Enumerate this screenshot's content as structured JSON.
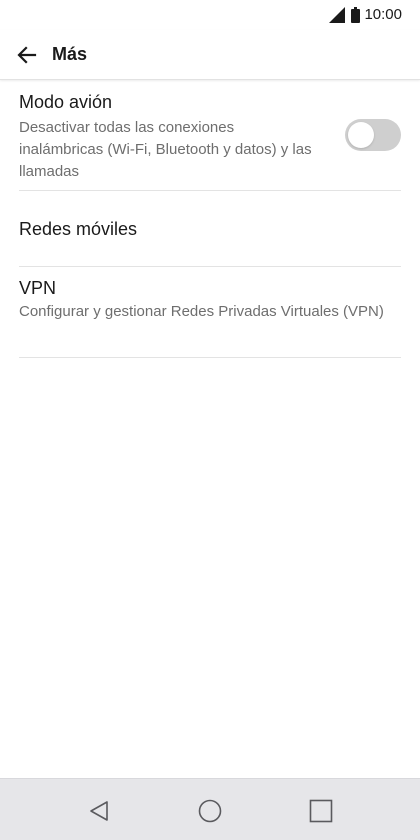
{
  "status_bar": {
    "time": "10:00",
    "icons": [
      "signal-icon",
      "battery-icon"
    ]
  },
  "app_bar": {
    "title": "Más",
    "back_icon": "arrow-left-icon"
  },
  "settings": {
    "airplane_mode": {
      "title": "Modo avión",
      "description": "Desactivar todas las conexiones inalámbricas (Wi-Fi, Bluetooth y datos) y las llamadas",
      "enabled": false
    },
    "mobile_networks": {
      "title": "Redes móviles"
    },
    "vpn": {
      "title": "VPN",
      "description": "Configurar y gestionar Redes Privadas Virtuales (VPN)"
    }
  },
  "nav_bar": {
    "icons": [
      "nav-back-icon",
      "nav-home-icon",
      "nav-recents-icon"
    ]
  },
  "colors": {
    "text_primary": "#1a1a1a",
    "text_secondary": "#6e6e6e",
    "divider": "#e3e3e3",
    "toggle_off": "#cfcfcf",
    "nav_bar": "#e6e6e9"
  }
}
